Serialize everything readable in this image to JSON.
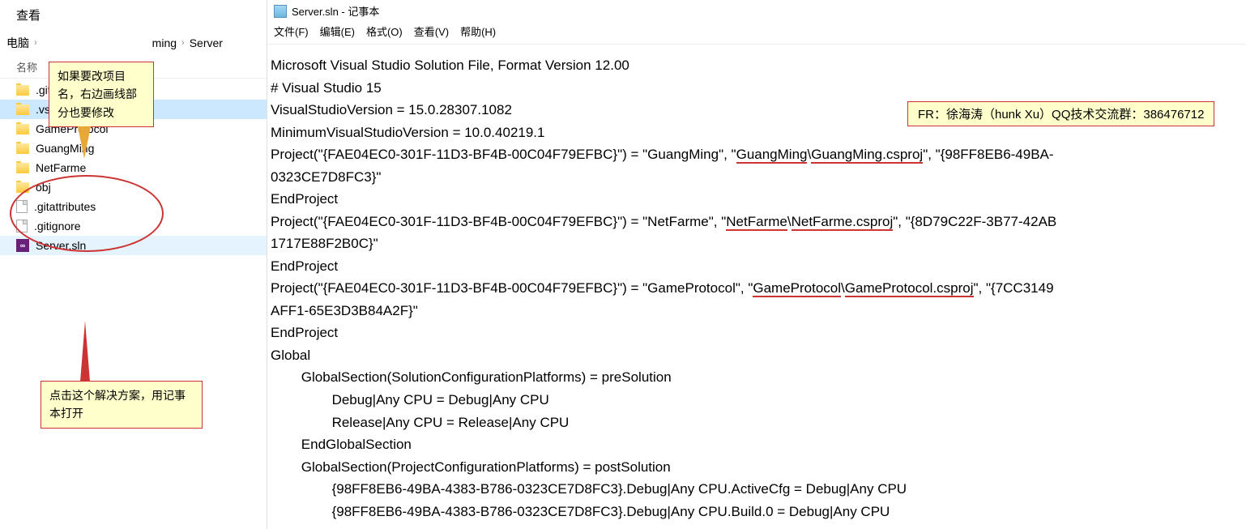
{
  "explorer": {
    "view_label": "查看",
    "breadcrumb": {
      "item1": "电脑",
      "item2": "ming",
      "item3": "Server",
      "sep": "›"
    },
    "col_name": "名称",
    "items": [
      {
        "label": ".git",
        "type": "folder"
      },
      {
        "label": ".vs",
        "type": "folder"
      },
      {
        "label": "GameProtocol",
        "type": "folder"
      },
      {
        "label": "GuangMing",
        "type": "folder"
      },
      {
        "label": "NetFarme",
        "type": "folder"
      },
      {
        "label": "obj",
        "type": "folder"
      },
      {
        "label": ".gitattributes",
        "type": "file"
      },
      {
        "label": ".gitignore",
        "type": "file"
      },
      {
        "label": "Server.sln",
        "type": "sln"
      }
    ]
  },
  "callouts": {
    "c1": "如果要改项目名，右边画线部分也要修改",
    "c2": "点击这个解决方案，用记事本打开",
    "c3": "FR：徐海涛（hunk Xu）QQ技术交流群：386476712"
  },
  "notepad": {
    "title": "Server.sln - 记事本",
    "menu": {
      "file": "文件(F)",
      "edit": "编辑(E)",
      "format": "格式(O)",
      "view": "查看(V)",
      "help": "帮助(H)"
    },
    "content": {
      "l1": "Microsoft Visual Studio Solution File, Format Version 12.00",
      "l2": "# Visual Studio 15",
      "l3": "VisualStudioVersion = 15.0.28307.1082",
      "l4": "MinimumVisualStudioVersion = 10.0.40219.1",
      "p1a": "Project(\"{FAE04EC0-301F-11D3-BF4B-00C04F79EFBC}\") = \"GuangMing\", \"",
      "p1b": "GuangMing",
      "p1c": "\\",
      "p1d": "GuangMing.csproj",
      "p1e": "\", \"{98FF8EB6-49BA-",
      "p1f": "0323CE7D8FC3}\"",
      "ep": "EndProject",
      "p2a": "Project(\"{FAE04EC0-301F-11D3-BF4B-00C04F79EFBC}\") = \"NetFarme\", \"",
      "p2b": "NetFarme",
      "p2c": "\\",
      "p2d": "NetFarme.csproj",
      "p2e": "\", \"{8D79C22F-3B77-42AB",
      "p2f": "1717E88F2B0C}\"",
      "p3a": "Project(\"{FAE04EC0-301F-11D3-BF4B-00C04F79EFBC}\") = \"GameProtocol\", \"",
      "p3b": "GameProtocol",
      "p3c": "\\",
      "p3d": "GameProtocol.csproj",
      "p3e": "\", \"{7CC3149",
      "p3f": "AFF1-65E3D3B84A2F}\"",
      "g1": "Global",
      "g2": "        GlobalSection(SolutionConfigurationPlatforms) = preSolution",
      "g3": "                Debug|Any CPU = Debug|Any CPU",
      "g4": "                Release|Any CPU = Release|Any CPU",
      "g5": "        EndGlobalSection",
      "g6": "        GlobalSection(ProjectConfigurationPlatforms) = postSolution",
      "g7": "                {98FF8EB6-49BA-4383-B786-0323CE7D8FC3}.Debug|Any CPU.ActiveCfg = Debug|Any CPU",
      "g8": "                {98FF8EB6-49BA-4383-B786-0323CE7D8FC3}.Debug|Any CPU.Build.0 = Debug|Any CPU"
    }
  }
}
